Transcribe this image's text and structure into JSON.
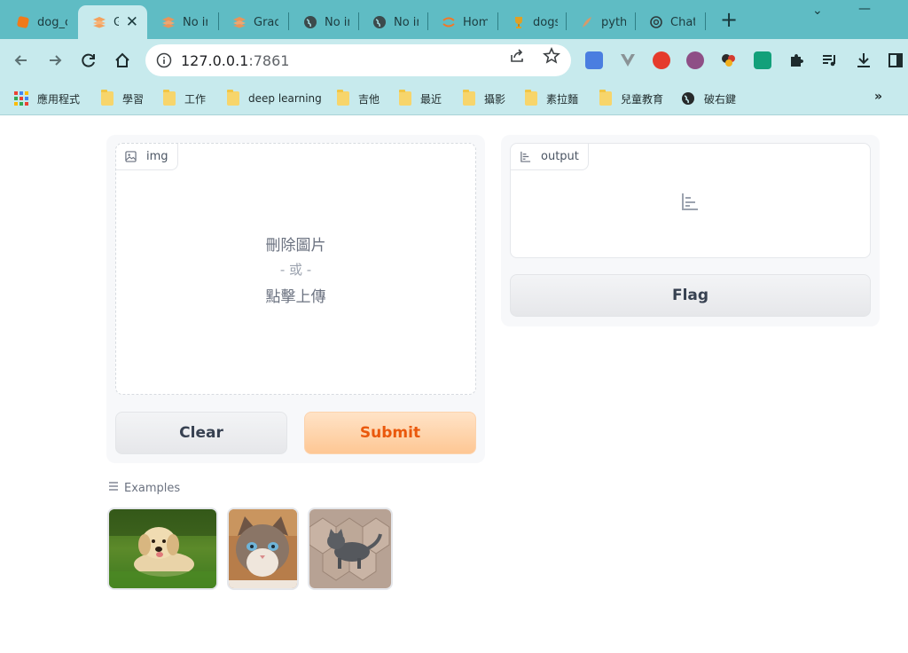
{
  "browser": {
    "tabs": [
      {
        "title": "dog_c",
        "icon": "orange-square-icon",
        "active": false
      },
      {
        "title": "G",
        "icon": "gradio-icon",
        "active": true
      },
      {
        "title": "No in",
        "icon": "gradio-icon",
        "active": false
      },
      {
        "title": "Gradi",
        "icon": "gradio-icon",
        "active": false
      },
      {
        "title": "No in",
        "icon": "globe-icon",
        "active": false
      },
      {
        "title": "No in",
        "icon": "globe-icon",
        "active": false
      },
      {
        "title": "Home",
        "icon": "jupyter-icon",
        "active": false
      },
      {
        "title": "dogs",
        "icon": "trophy-icon",
        "active": false
      },
      {
        "title": "pytho",
        "icon": "feather-icon",
        "active": false
      },
      {
        "title": "Chat",
        "icon": "openai-icon",
        "active": false
      }
    ],
    "close_symbol": "✕",
    "new_tab_symbol": "+",
    "window_controls": {
      "collapse": "⌄",
      "minimize": "—"
    },
    "address": {
      "host": "127.0.0.1",
      "port": ":7861"
    },
    "bookmarks": [
      {
        "label": "應用程式",
        "icon": "apps-grid-icon"
      },
      {
        "label": "學習",
        "icon": "folder-icon"
      },
      {
        "label": "工作",
        "icon": "folder-icon"
      },
      {
        "label": "deep learning",
        "icon": "folder-icon"
      },
      {
        "label": "吉他",
        "icon": "folder-icon"
      },
      {
        "label": "最近",
        "icon": "folder-icon"
      },
      {
        "label": "攝影",
        "icon": "folder-icon"
      },
      {
        "label": "素拉麵",
        "icon": "folder-icon"
      },
      {
        "label": "兒童教育",
        "icon": "folder-icon"
      },
      {
        "label": "破右鍵",
        "icon": "globe-icon"
      }
    ],
    "bookmarks_overflow": "»"
  },
  "app": {
    "input": {
      "label": "img",
      "drop_line1": "刪除圖片",
      "drop_or": "- 或 -",
      "drop_line2": "點擊上傳"
    },
    "output": {
      "label": "output"
    },
    "buttons": {
      "clear": "Clear",
      "submit": "Submit",
      "flag": "Flag"
    },
    "examples": {
      "title": "Examples",
      "items": [
        {
          "subject": "golden retriever puppy on grass"
        },
        {
          "subject": "tabby kitten with blue eyes"
        },
        {
          "subject": "grey kitten on hexagon paving"
        }
      ]
    },
    "colors": {
      "primary": "#ea580c",
      "primary_bg": "#fec794",
      "tab_strip": "#5fbcc4",
      "toolbar": "#c7eaed"
    }
  }
}
